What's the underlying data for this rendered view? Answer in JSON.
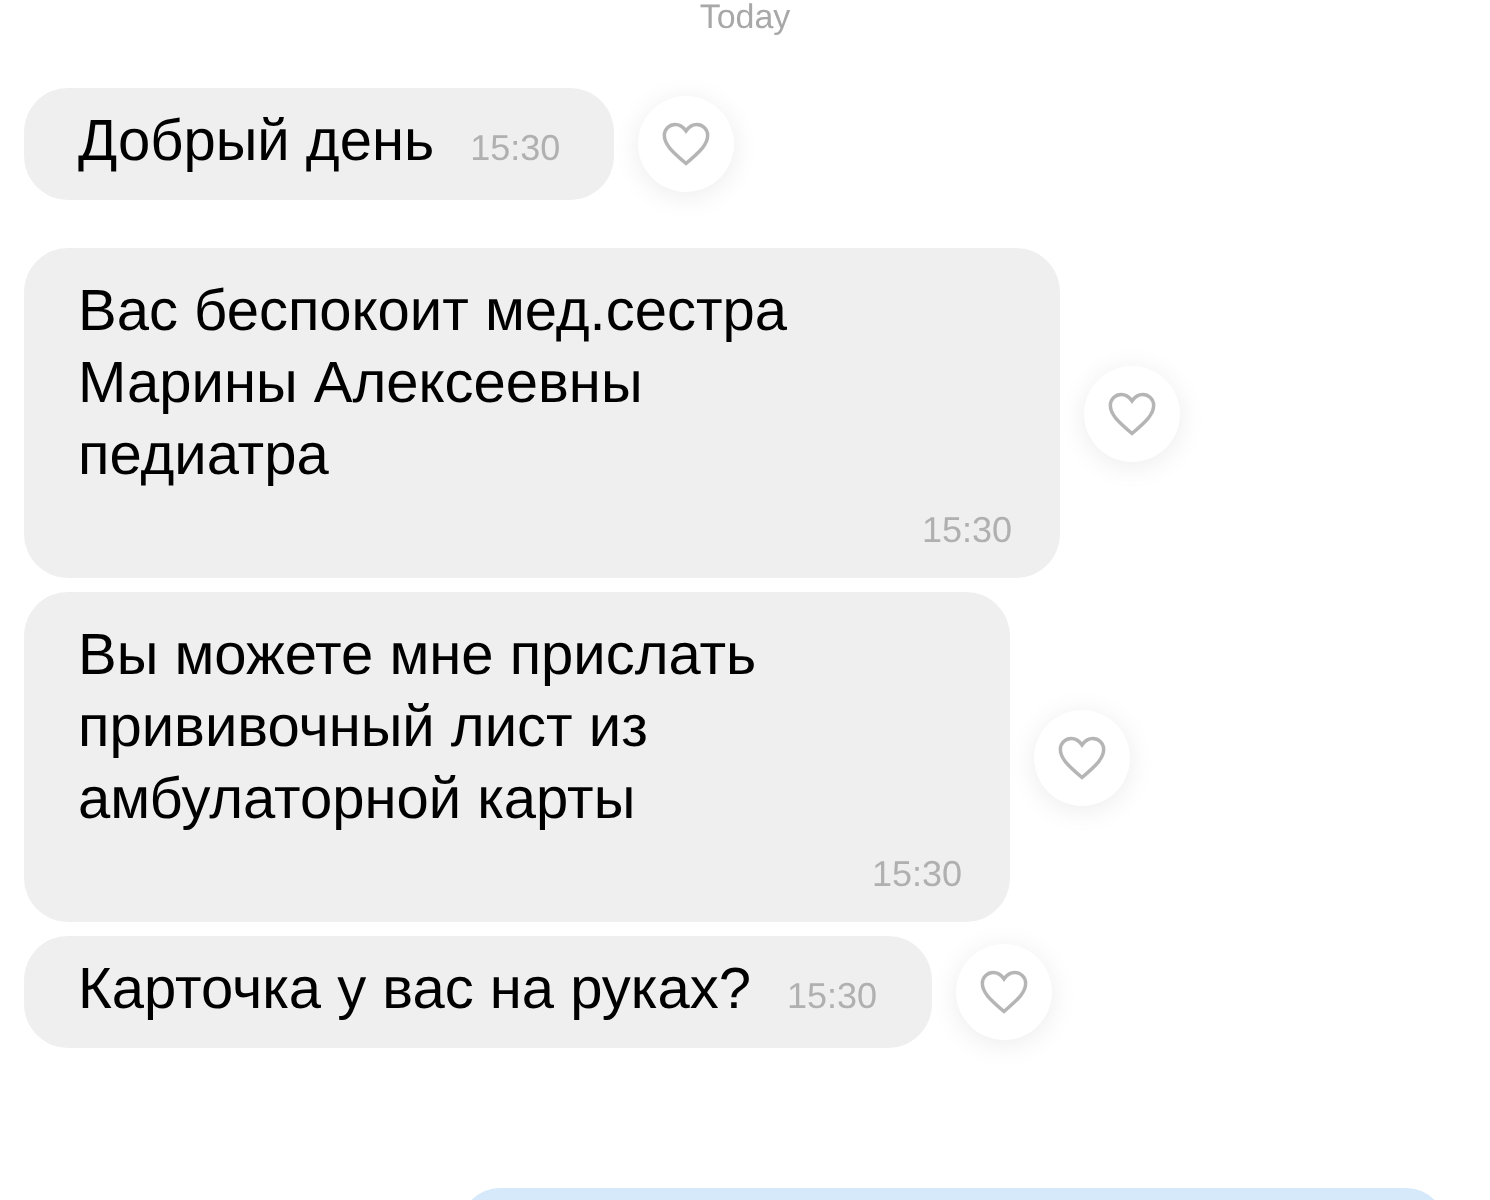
{
  "date_separator": "Today",
  "messages": [
    {
      "kind": "inline",
      "text": "Добрый день",
      "time": "15:30",
      "liked": false
    },
    {
      "kind": "block",
      "text": "Вас беспокоит мед.сестра Марины Алексеевны педиатра",
      "time": "15:30",
      "liked": false
    },
    {
      "kind": "block",
      "text": "Вы можете мне прислать прививочный лист из амбулаторной карты",
      "time": "15:30",
      "liked": false
    },
    {
      "kind": "inline",
      "text": "Карточка у вас на руках?",
      "time": "15:30",
      "liked": false
    }
  ]
}
